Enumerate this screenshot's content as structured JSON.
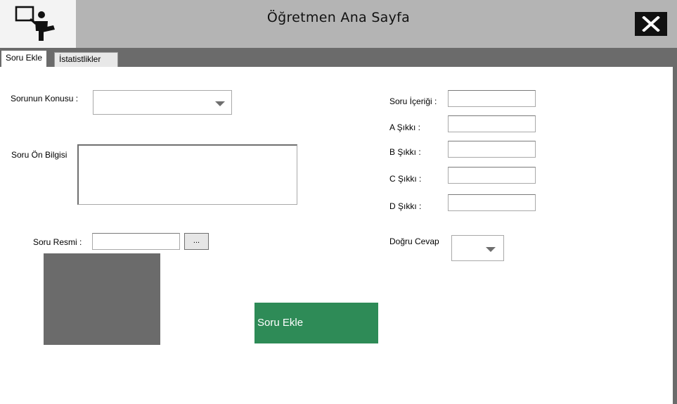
{
  "window": {
    "title": "Öğretmen Ana Sayfa",
    "logo_icon": "teacher-presentation-icon",
    "close_icon": "close-icon"
  },
  "tabs": [
    {
      "label": "Soru Ekle",
      "active": true
    },
    {
      "label": "İstatistlikler",
      "active": false
    }
  ],
  "form": {
    "topic_label": "Sorunun Konusu :",
    "topic_value": "",
    "preinfo_label": "Soru Ön Bilgisi",
    "preinfo_value": "",
    "image_label": "Soru Resmi :",
    "image_path": "",
    "browse_label": "...",
    "content_label": "Soru İçeriği :",
    "option_a_label": "A Şıkkı :",
    "option_b_label": "B Şıkkı :",
    "option_c_label": "C Şıkkı :",
    "option_d_label": "D Şıkkı :",
    "correct_answer_label": "Doğru Cevap",
    "correct_answer_value": "",
    "submit_label": "Soru Ekle"
  },
  "colors": {
    "titlebar": "#b4b4b4",
    "tabstrip": "#6b6b6b",
    "picture_placeholder": "#6b6b6b",
    "submit_button": "#2e8b57"
  }
}
